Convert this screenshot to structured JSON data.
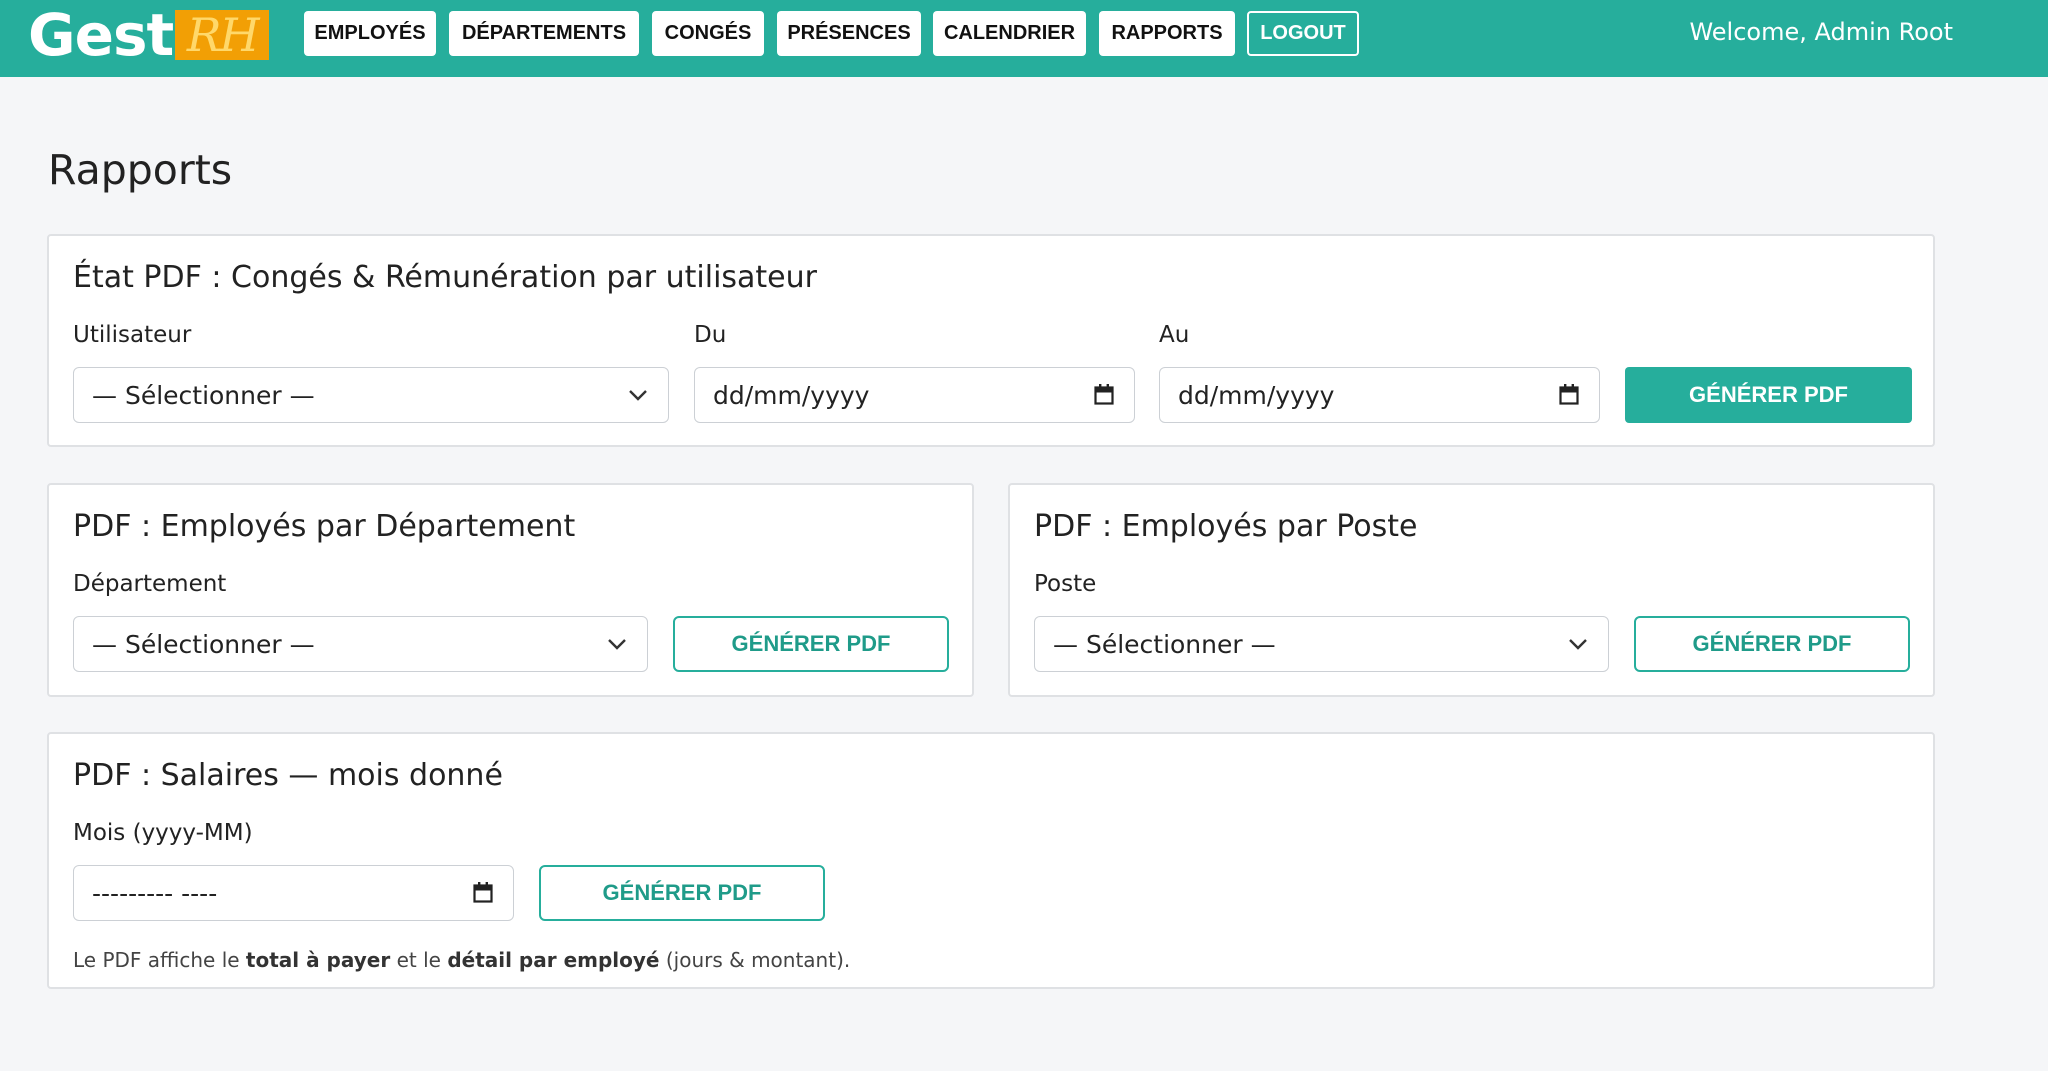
{
  "brand": {
    "text": "Gest",
    "badge": "RH",
    "badge_color": "#f29f05"
  },
  "colors": {
    "accent": "#26ae9c",
    "background": "#f5f6f8"
  },
  "nav": {
    "items": [
      "EMPLOYÉS",
      "DÉPARTEMENTS",
      "CONGÉS",
      "PRÉSENCES",
      "CALENDRIER",
      "RAPPORTS"
    ],
    "logout": "LOGOUT"
  },
  "welcome": "Welcome, Admin Root",
  "page_title": "Rapports",
  "card_user": {
    "title": "État PDF : Congés & Rémunération par utilisateur",
    "user_label": "Utilisateur",
    "user_select": "— Sélectionner —",
    "from_label": "Du",
    "from_value": "dd/mm/yyyy",
    "to_label": "Au",
    "to_value": "dd/mm/yyyy",
    "button": "GÉNÉRER PDF"
  },
  "card_dept": {
    "title": "PDF : Employés par Département",
    "label": "Département",
    "select": "— Sélectionner —",
    "button": "GÉNÉRER PDF"
  },
  "card_poste": {
    "title": "PDF : Employés par Poste",
    "label": "Poste",
    "select": "— Sélectionner —",
    "button": "GÉNÉRER PDF"
  },
  "card_salary": {
    "title": "PDF : Salaires — mois donné",
    "label": "Mois (yyyy-MM)",
    "month_value": "--------- ----",
    "button": "GÉNÉRER PDF",
    "note_pre": "Le PDF affiche le ",
    "note_b1": "total à payer",
    "note_mid": " et le ",
    "note_b2": "détail par employé",
    "note_post": " (jours & montant)."
  }
}
